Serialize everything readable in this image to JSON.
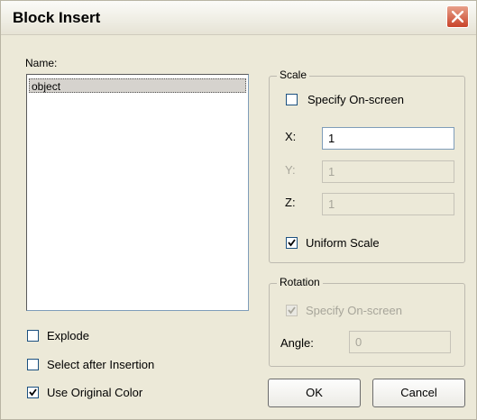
{
  "window": {
    "title": "Block Insert",
    "close_icon": "close-icon"
  },
  "name": {
    "label": "Name:",
    "items": [
      "object"
    ],
    "selected": "object"
  },
  "scale": {
    "group_label": "Scale",
    "specify_on_screen": {
      "label": "Specify On-screen",
      "checked": false
    },
    "x": {
      "label": "X:",
      "value": "1"
    },
    "y": {
      "label": "Y:",
      "value": "1"
    },
    "z": {
      "label": "Z:",
      "value": "1"
    },
    "uniform_scale": {
      "label": "Uniform Scale",
      "checked": true
    }
  },
  "rotation": {
    "group_label": "Rotation",
    "specify_on_screen": {
      "label": "Specify On-screen",
      "checked": true,
      "disabled": true
    },
    "angle": {
      "label": "Angle:",
      "value": "0"
    }
  },
  "options": {
    "explode": {
      "label": "Explode",
      "checked": false
    },
    "select_after_insertion": {
      "label": "Select after Insertion",
      "checked": false
    },
    "use_original_color": {
      "label": "Use Original Color",
      "checked": true
    }
  },
  "buttons": {
    "ok": "OK",
    "cancel": "Cancel"
  },
  "colors": {
    "dialog_bg": "#ece9d8",
    "close_button": "#c9432a",
    "input_border": "#7f9db9"
  }
}
